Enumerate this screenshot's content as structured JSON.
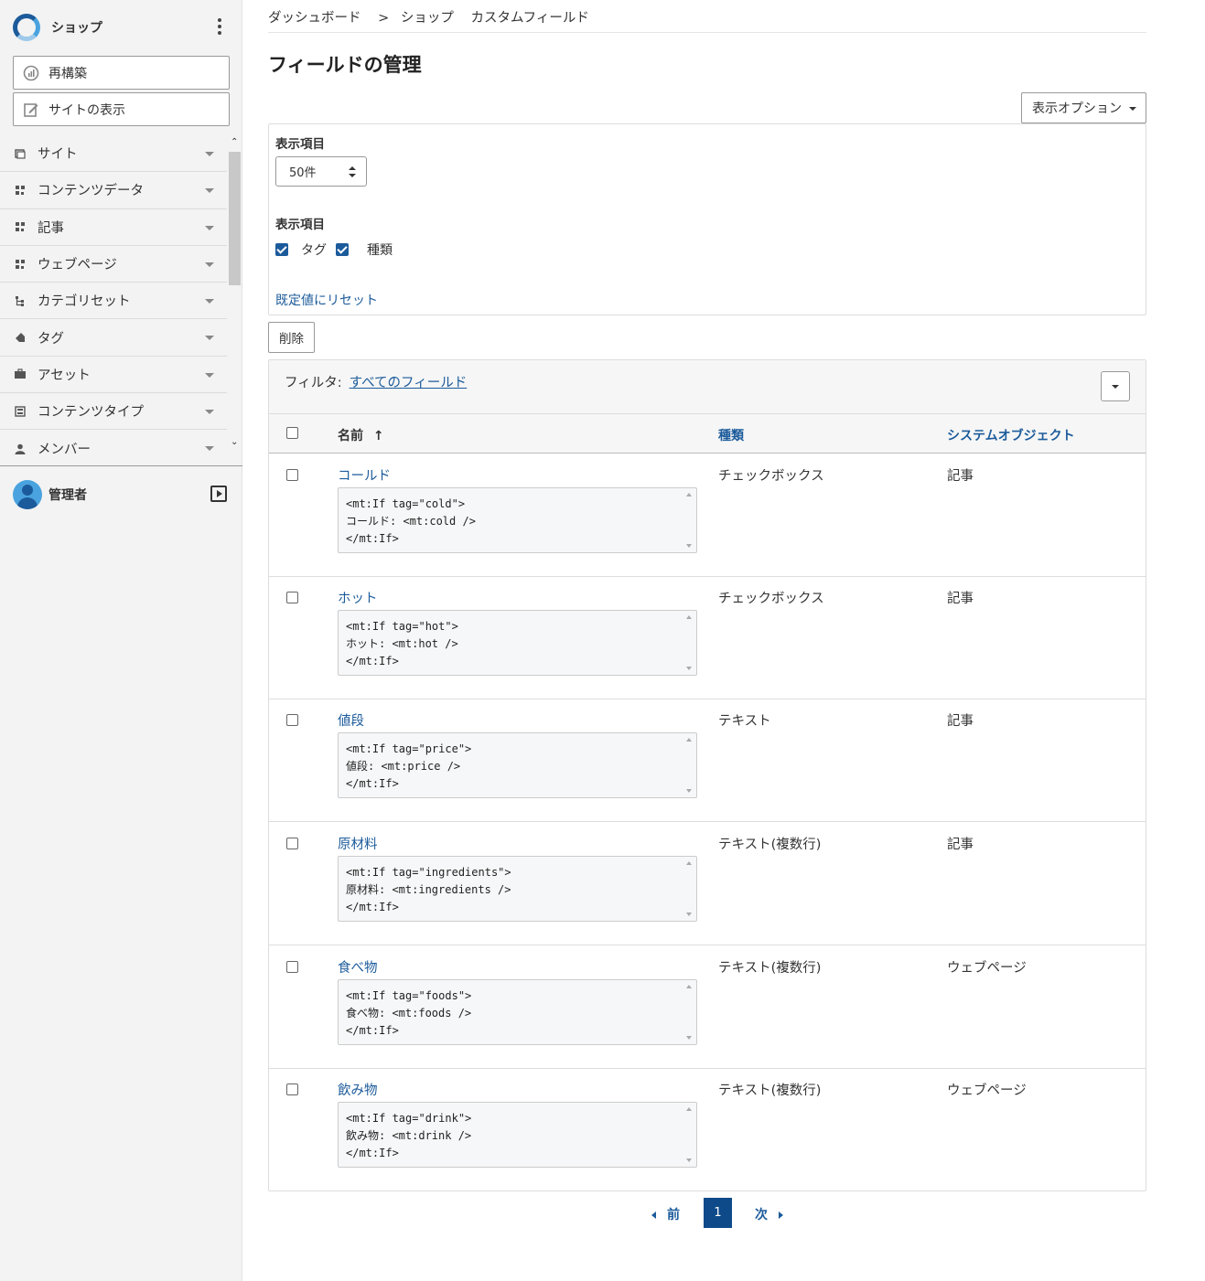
{
  "sidebar": {
    "site_name": "ショップ",
    "rebuild_label": "再構築",
    "view_site_label": "サイトの表示",
    "nav": [
      {
        "label": "サイト",
        "icon": "site-icon"
      },
      {
        "label": "コンテンツデータ",
        "icon": "content-data-icon"
      },
      {
        "label": "記事",
        "icon": "entry-icon"
      },
      {
        "label": "ウェブページ",
        "icon": "webpage-icon"
      },
      {
        "label": "カテゴリセット",
        "icon": "category-set-icon"
      },
      {
        "label": "タグ",
        "icon": "tag-icon"
      },
      {
        "label": "アセット",
        "icon": "asset-icon"
      },
      {
        "label": "コンテンツタイプ",
        "icon": "content-type-icon"
      },
      {
        "label": "メンバー",
        "icon": "member-icon"
      }
    ],
    "user_name": "管理者"
  },
  "breadcrumb": [
    "ダッシュボード",
    ">",
    "ショップ",
    "カスタムフィールド"
  ],
  "page_title": "フィールドの管理",
  "display_options": {
    "button_label": "表示オプション",
    "limit_label": "表示項目",
    "limit_value": "50件",
    "columns_label": "表示項目",
    "columns": [
      {
        "label": "タグ",
        "checked": true
      },
      {
        "label": "種類",
        "checked": true
      }
    ],
    "reset_label": "既定値にリセット"
  },
  "delete_label": "削除",
  "filter": {
    "label": "フィルタ:",
    "value": "すべてのフィールド"
  },
  "table": {
    "headers": {
      "name": "名前",
      "sort_indicator": "↑",
      "type": "種類",
      "object": "システムオブジェクト"
    },
    "rows": [
      {
        "name": "コールド",
        "code": "<mt:If tag=\"cold\">\nコールド: <mt:cold />\n</mt:If>",
        "type": "チェックボックス",
        "object": "記事"
      },
      {
        "name": "ホット",
        "code": "<mt:If tag=\"hot\">\nホット: <mt:hot />\n</mt:If>",
        "type": "チェックボックス",
        "object": "記事"
      },
      {
        "name": "値段",
        "code": "<mt:If tag=\"price\">\n値段: <mt:price />\n</mt:If>",
        "type": "テキスト",
        "object": "記事"
      },
      {
        "name": "原材料",
        "code": "<mt:If tag=\"ingredients\">\n原材料: <mt:ingredients />\n</mt:If>",
        "type": "テキスト(複数行)",
        "object": "記事"
      },
      {
        "name": "食べ物",
        "code": "<mt:If tag=\"foods\">\n食べ物: <mt:foods />\n</mt:If>",
        "type": "テキスト(複数行)",
        "object": "ウェブページ"
      },
      {
        "name": "飲み物",
        "code": "<mt:If tag=\"drink\">\n飲み物: <mt:drink />\n</mt:If>",
        "type": "テキスト(複数行)",
        "object": "ウェブページ"
      }
    ]
  },
  "pager": {
    "prev": "前",
    "current": "1",
    "next": "次"
  },
  "colors": {
    "accent": "#1c5b9b",
    "pager_active": "#0e4a8a",
    "sidebar_bg": "#f3f3f3"
  }
}
